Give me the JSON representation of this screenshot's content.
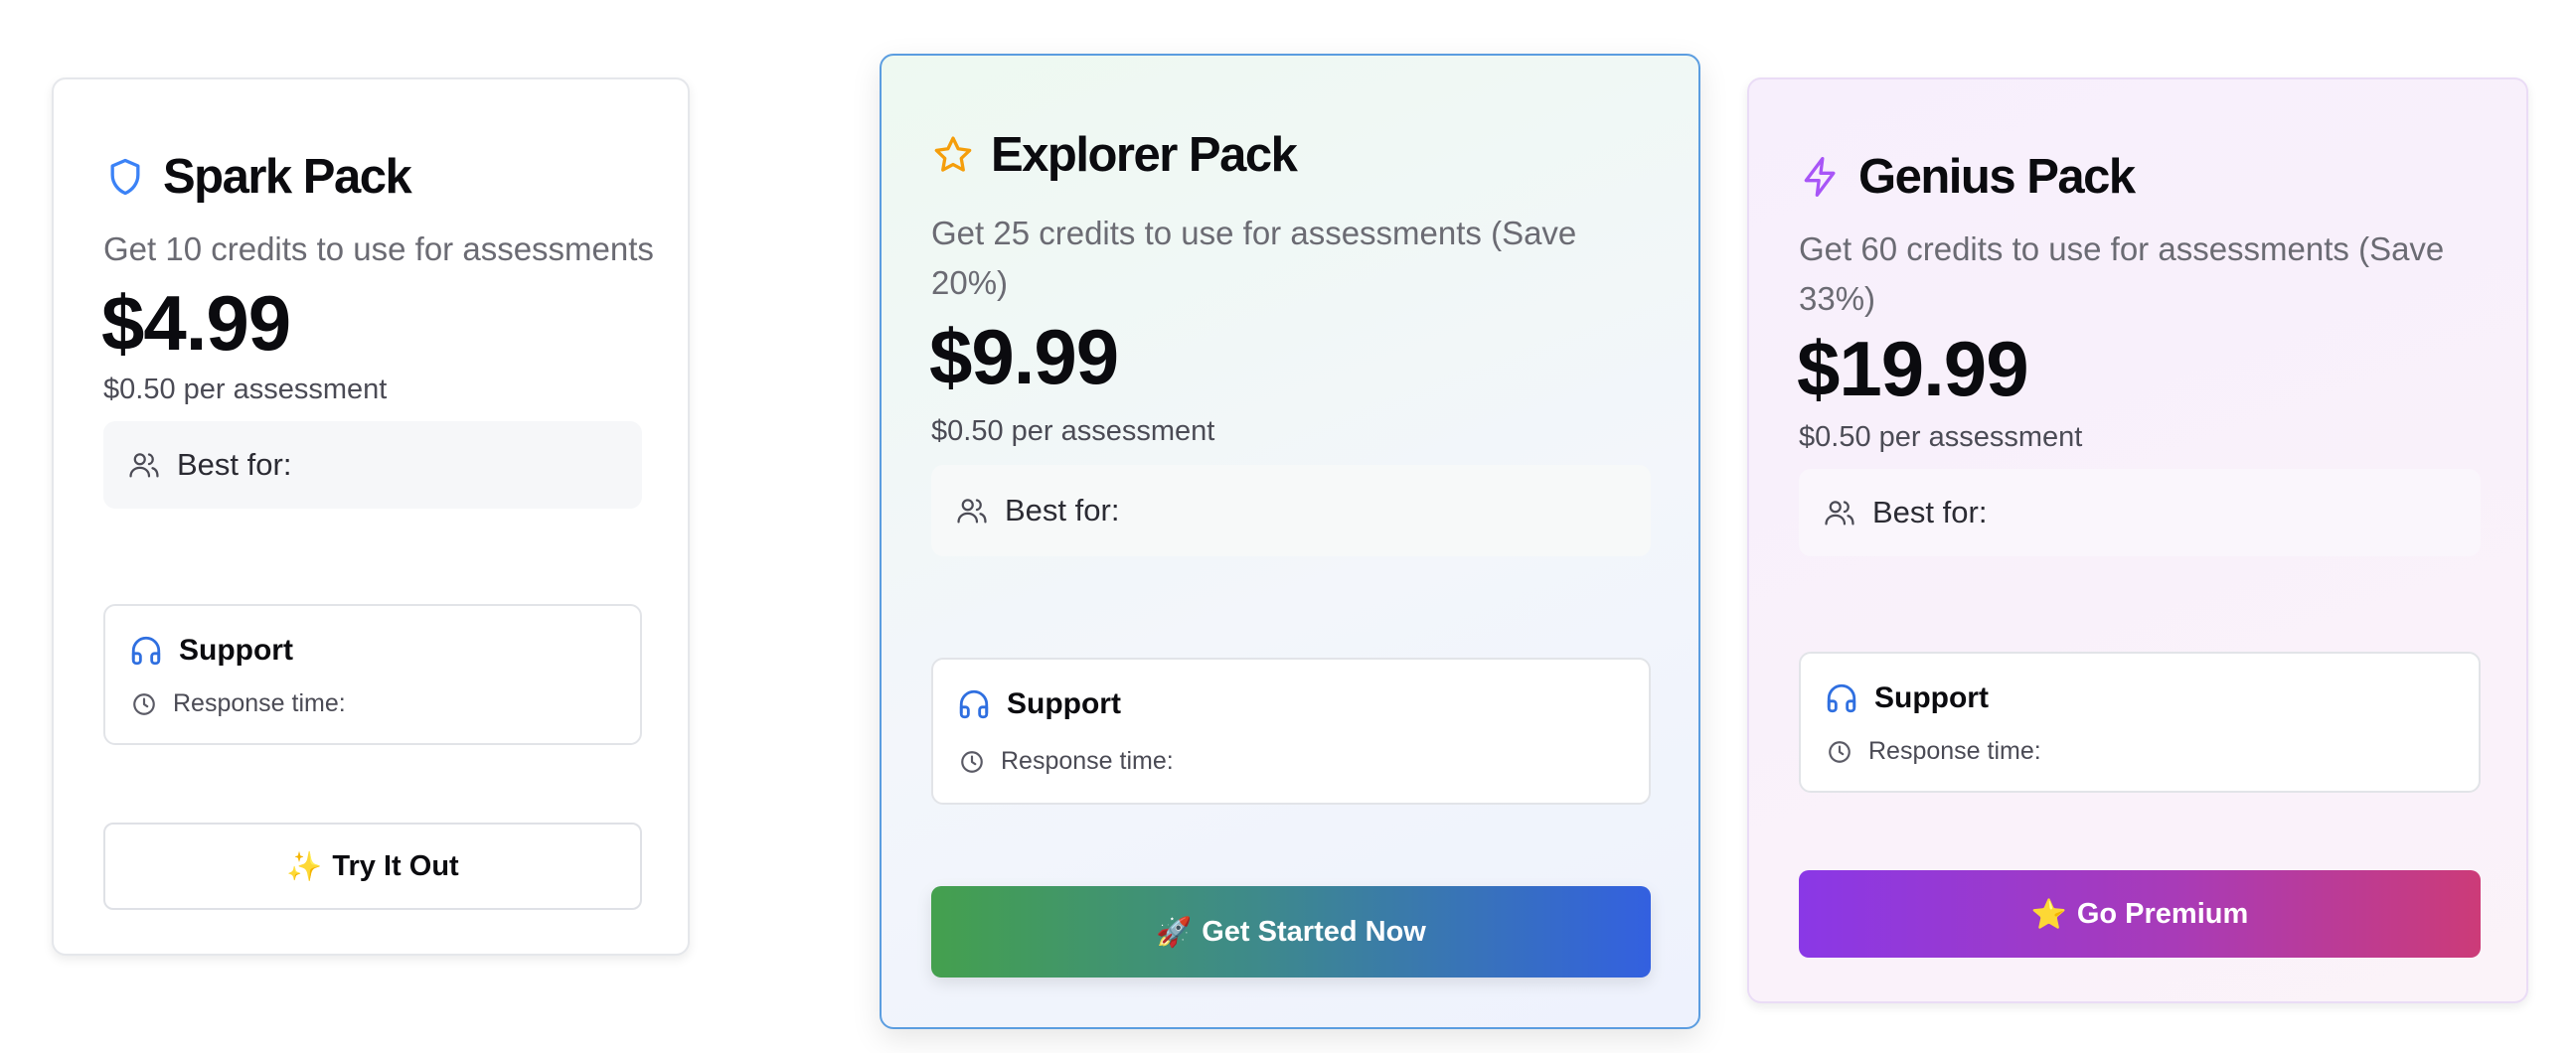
{
  "plans": [
    {
      "name": "Spark Pack",
      "icon": "shield-icon",
      "icon_color": "#3b82f6",
      "description": "Get 10 credits to use for assessments",
      "price": "$4.99",
      "per_assessment": "$0.50 per assessment",
      "best_for_label": "Best for:",
      "support_label": "Support",
      "response_label": "Response time:",
      "button_emoji": "✨",
      "button_label": "Try It Out"
    },
    {
      "name": "Explorer Pack",
      "icon": "star-icon",
      "icon_color": "#f59e0b",
      "description": "Get 25 credits to use for assessments (Save 20%)",
      "price": "$9.99",
      "per_assessment": "$0.50 per assessment",
      "best_for_label": "Best for:",
      "support_label": "Support",
      "response_label": "Response time:",
      "button_emoji": "🚀",
      "button_label": "Get Started Now"
    },
    {
      "name": "Genius Pack",
      "icon": "lightning-icon",
      "icon_color": "#a855f7",
      "description": "Get 60 credits to use for assessments (Save 33%)",
      "price": "$19.99",
      "per_assessment": "$0.50 per assessment",
      "best_for_label": "Best for:",
      "support_label": "Support",
      "response_label": "Response time:",
      "button_emoji": "⭐",
      "button_label": "Go Premium"
    }
  ]
}
